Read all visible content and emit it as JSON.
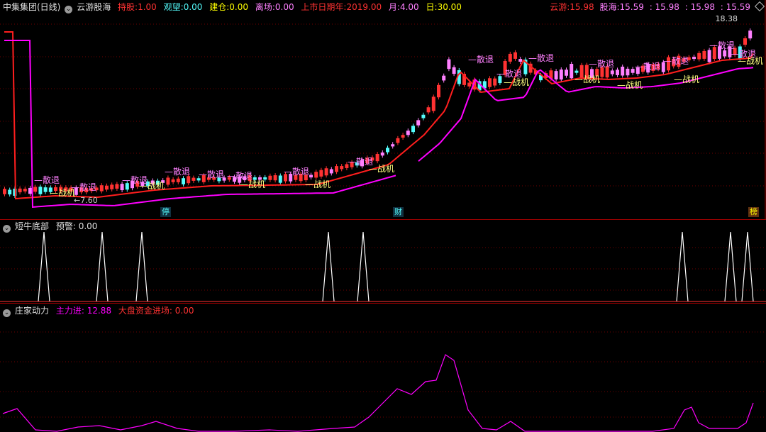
{
  "main": {
    "stock": "中集集团(日线)",
    "indicator": "云游股海",
    "chi_gu": {
      "label": "持股:",
      "value": "1.00"
    },
    "guan_wang": {
      "label": "观望:",
      "value": "0.00"
    },
    "jian_cang": {
      "label": "建仓:",
      "value": "0.00"
    },
    "li_chang": {
      "label": "离场:",
      "value": "0.00"
    },
    "list_date": {
      "label": "上市日期年:",
      "value": "2019.00"
    },
    "month": {
      "label": "月:",
      "value": "4.00"
    },
    "day": {
      "label": "日:",
      "value": "30.00"
    },
    "yunyou": {
      "label": "云游:",
      "value": "15.98"
    },
    "guhai": {
      "label": "股海:",
      "value": "15.59"
    },
    "v3": "15.98",
    "v4": "15.98",
    "v5": "15.59",
    "max_price": "18.38",
    "low_price": "7.60",
    "signal_exit": "散退",
    "signal_entry": "战机",
    "tag_ting": "停",
    "tag_cai": "财",
    "tag_bang": "榜"
  },
  "panel2": {
    "title": "短牛底部",
    "alert": {
      "label": "预警:",
      "value": "0.00"
    }
  },
  "panel3": {
    "title": "庄家动力",
    "main_force": {
      "label": "主力进:",
      "value": "12.88"
    },
    "market_fund": {
      "label": "大盘资金进场:",
      "value": "0.00"
    }
  },
  "colors": {
    "red": "#ff3232",
    "cyan": "#54fcfc",
    "pink": "#ff80ff",
    "magenta": "#ff00ff",
    "yellow": "#ffff00",
    "dark_red": "#a00000"
  }
}
